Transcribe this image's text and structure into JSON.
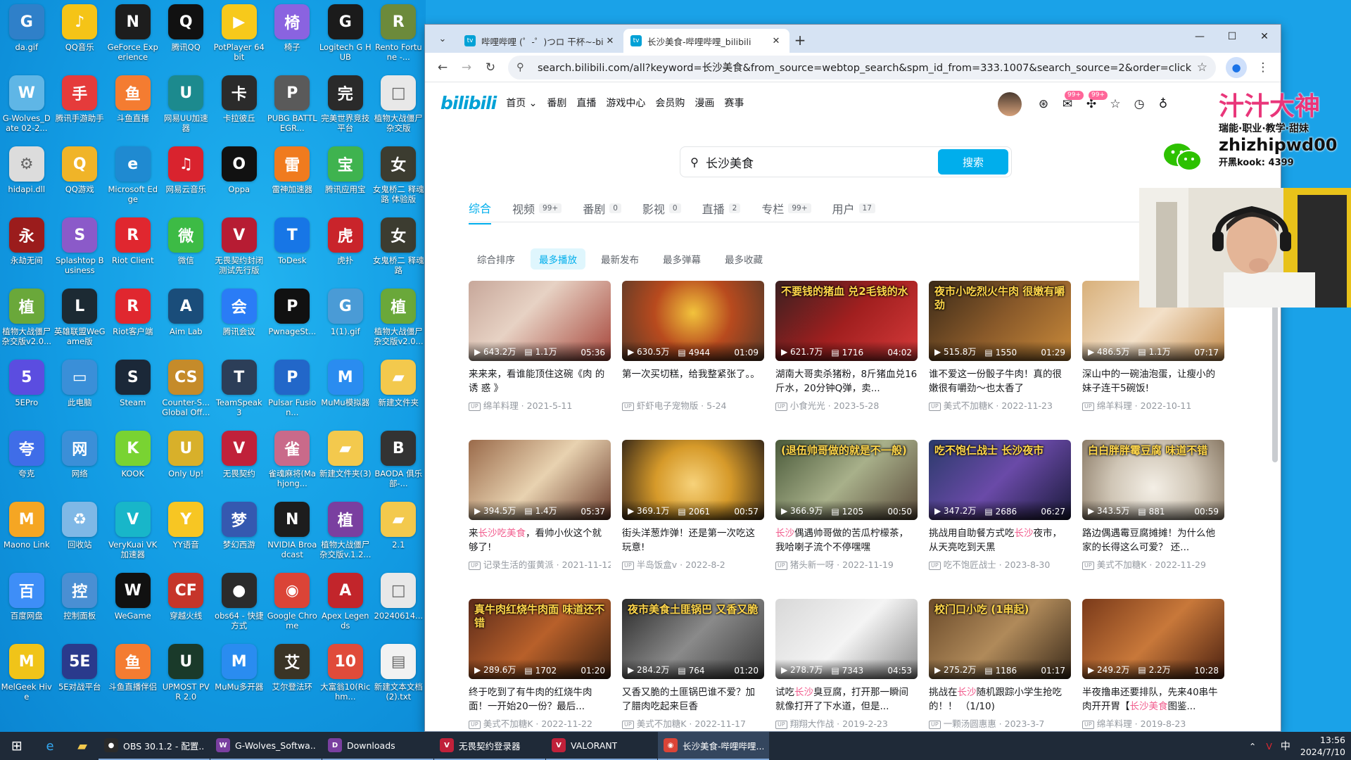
{
  "desktop": {
    "icons": [
      {
        "label": "da.gif",
        "color": "#2f80c9",
        "glyph": "G"
      },
      {
        "label": "QQ音乐",
        "color": "#f5c417",
        "glyph": "♪"
      },
      {
        "label": "GeForce Experience",
        "color": "#1d1d1d",
        "glyph": "N"
      },
      {
        "label": "腾讯QQ",
        "color": "#111111",
        "glyph": "Q"
      },
      {
        "label": "PotPlayer 64 bit",
        "color": "#f7c91b",
        "glyph": "▶"
      },
      {
        "label": "椅子",
        "color": "#8a63e0",
        "glyph": "椅"
      },
      {
        "label": "Logitech G HUB",
        "color": "#1b1b1b",
        "glyph": "G"
      },
      {
        "label": "Rento Fortune -...",
        "color": "#6c8a3b",
        "glyph": "R"
      },
      {
        "label": "G-Wolves_Date 02-2...",
        "color": "#5fb6e6",
        "glyph": "W"
      },
      {
        "label": "腾讯手游助手",
        "color": "#e53b3b",
        "glyph": "手"
      },
      {
        "label": "斗鱼直播",
        "color": "#f47c31",
        "glyph": "鱼"
      },
      {
        "label": "网易UU加速器",
        "color": "#1c8a8e",
        "glyph": "U"
      },
      {
        "label": "卡拉彼丘",
        "color": "#2b2b2b",
        "glyph": "卡"
      },
      {
        "label": "PUBG BATTLEGR...",
        "color": "#5a5a5a",
        "glyph": "P"
      },
      {
        "label": "完美世界竞技平台",
        "color": "#2a2a2a",
        "glyph": "完"
      },
      {
        "label": "植物大战僵尸杂交版",
        "color": "#e8e8e8",
        "glyph": "□"
      },
      {
        "label": "hidapi.dll",
        "color": "#dcdcdc",
        "glyph": "⚙"
      },
      {
        "label": "QQ游戏",
        "color": "#f0b428",
        "glyph": "Q"
      },
      {
        "label": "Microsoft Edge",
        "color": "#1f8ad1",
        "glyph": "e"
      },
      {
        "label": "网易云音乐",
        "color": "#d9232e",
        "glyph": "♫"
      },
      {
        "label": "Oppa",
        "color": "#111111",
        "glyph": "O"
      },
      {
        "label": "雷神加速器",
        "color": "#f07b1e",
        "glyph": "雷"
      },
      {
        "label": "腾讯应用宝",
        "color": "#3fb34f",
        "glyph": "宝"
      },
      {
        "label": "女鬼桥二 释魂路 体验版",
        "color": "#3c3c30",
        "glyph": "女"
      },
      {
        "label": "永劫无间",
        "color": "#9b1c1c",
        "glyph": "永"
      },
      {
        "label": "Splashtop Business",
        "color": "#8b5ac9",
        "glyph": "S"
      },
      {
        "label": "Riot Client",
        "color": "#e0272f",
        "glyph": "R"
      },
      {
        "label": "微信",
        "color": "#3dbb45",
        "glyph": "微"
      },
      {
        "label": "无畏契约封闭测试先行版",
        "color": "#b71c33",
        "glyph": "V"
      },
      {
        "label": "ToDesk",
        "color": "#1776e6",
        "glyph": "T"
      },
      {
        "label": "虎扑",
        "color": "#c9242b",
        "glyph": "虎"
      },
      {
        "label": "女鬼桥二 释魂路",
        "color": "#3c3c30",
        "glyph": "女"
      },
      {
        "label": "植物大战僵尸杂交版v2.0...",
        "color": "#6aa83a",
        "glyph": "植"
      },
      {
        "label": "英雄联盟WeGame版",
        "color": "#1c2a33",
        "glyph": "L"
      },
      {
        "label": "Riot客户端",
        "color": "#e0272f",
        "glyph": "R"
      },
      {
        "label": "Aim Lab",
        "color": "#1a4d7a",
        "glyph": "A"
      },
      {
        "label": "腾讯会议",
        "color": "#2a7cf6",
        "glyph": "会"
      },
      {
        "label": "PwnageSt...",
        "color": "#111111",
        "glyph": "P"
      },
      {
        "label": "1(1).gif",
        "color": "#4a9bd6",
        "glyph": "G"
      },
      {
        "label": "植物大战僵尸杂交版v2.0...",
        "color": "#6aa83a",
        "glyph": "植"
      },
      {
        "label": "5EPro",
        "color": "#5b4de0",
        "glyph": "5"
      },
      {
        "label": "此电脑",
        "color": "#3a8fd8",
        "glyph": "▭"
      },
      {
        "label": "Steam",
        "color": "#1b2838",
        "glyph": "S"
      },
      {
        "label": "Counter-S... Global Off...",
        "color": "#c58b2a",
        "glyph": "CS"
      },
      {
        "label": "TeamSpeak 3",
        "color": "#2c3e58",
        "glyph": "T"
      },
      {
        "label": "Pulsar Fusion...",
        "color": "#2267c9",
        "glyph": "P"
      },
      {
        "label": "MuMu模拟器",
        "color": "#2a8cf0",
        "glyph": "M"
      },
      {
        "label": "新建文件夹",
        "color": "#f3c94d",
        "glyph": "▰"
      },
      {
        "label": "夸克",
        "color": "#3f6de8",
        "glyph": "夸"
      },
      {
        "label": "网络",
        "color": "#3b8fd8",
        "glyph": "网"
      },
      {
        "label": "KOOK",
        "color": "#79d332",
        "glyph": "K"
      },
      {
        "label": "Only Up!",
        "color": "#d8b02a",
        "glyph": "U"
      },
      {
        "label": "无畏契约",
        "color": "#c0213a",
        "glyph": "V"
      },
      {
        "label": "雀魂麻将(Mahjong...",
        "color": "#c96a8a",
        "glyph": "雀"
      },
      {
        "label": "新建文件夹(3)",
        "color": "#f3c94d",
        "glyph": "▰"
      },
      {
        "label": "BAODA 俱乐部-...",
        "color": "#333333",
        "glyph": "B"
      },
      {
        "label": "Maono Link",
        "color": "#f5a623",
        "glyph": "M"
      },
      {
        "label": "回收站",
        "color": "#7fb8e6",
        "glyph": "♻"
      },
      {
        "label": "VeryKuai VK加速器",
        "color": "#18b6c9",
        "glyph": "V"
      },
      {
        "label": "YY语音",
        "color": "#f7c623",
        "glyph": "Y"
      },
      {
        "label": "梦幻西游",
        "color": "#3559b0",
        "glyph": "梦"
      },
      {
        "label": "NVIDIA Broadcast",
        "color": "#1d1d1d",
        "glyph": "N"
      },
      {
        "label": "植物大战僵尸杂交版v.1.2...",
        "color": "#7a3fa0",
        "glyph": "植"
      },
      {
        "label": "2.1",
        "color": "#f3c94d",
        "glyph": "▰"
      },
      {
        "label": "百度网盘",
        "color": "#3e8ef7",
        "glyph": "百"
      },
      {
        "label": "控制面板",
        "color": "#4a8fd3",
        "glyph": "控"
      },
      {
        "label": "WeGame",
        "color": "#111111",
        "glyph": "W"
      },
      {
        "label": "穿越火线",
        "color": "#c6352a",
        "glyph": "CF"
      },
      {
        "label": "obs64 - 快捷方式",
        "color": "#2b2b2b",
        "glyph": "●"
      },
      {
        "label": "Google Chrome",
        "color": "#db4437",
        "glyph": "◉"
      },
      {
        "label": "Apex Legends",
        "color": "#c2252b",
        "glyph": "A"
      },
      {
        "label": "20240614...",
        "color": "#e8e8e8",
        "glyph": "□"
      },
      {
        "label": "MelGeek Hive",
        "color": "#f0c419",
        "glyph": "M"
      },
      {
        "label": "5E对战平台",
        "color": "#2a3a8c",
        "glyph": "5E"
      },
      {
        "label": "斗鱼直播伴侣",
        "color": "#f47c31",
        "glyph": "鱼"
      },
      {
        "label": "UPMOST PVR 2.0",
        "color": "#1a3a2a",
        "glyph": "U"
      },
      {
        "label": "MuMu多开器",
        "color": "#2a8cf0",
        "glyph": "M"
      },
      {
        "label": "艾尔登法环",
        "color": "#3a3426",
        "glyph": "艾"
      },
      {
        "label": "大富翁10(Richm...",
        "color": "#e04b3a",
        "glyph": "10"
      },
      {
        "label": "新建文本文档(2).txt",
        "color": "#f2f2f2",
        "glyph": "▤"
      }
    ]
  },
  "browser": {
    "tabs": [
      {
        "title": "哔哩哔哩 (゜-゜)つロ 干杯~-bi",
        "active": false
      },
      {
        "title": "长沙美食-哔哩哔哩_bilibili",
        "active": true
      }
    ],
    "url": "search.bilibili.com/all?keyword=长沙美食&from_source=webtop_search&spm_id_from=333.1007&search_source=2&order=click"
  },
  "bili": {
    "logo": "bilibili",
    "nav": [
      "首页",
      "番剧",
      "直播",
      "游戏中心",
      "会员购",
      "漫画",
      "赛事"
    ],
    "badges": [
      "99+",
      "99+"
    ],
    "search_query": "长沙美食",
    "search_button": "搜索",
    "type_tabs": [
      {
        "label": "综合",
        "count": ""
      },
      {
        "label": "视频",
        "count": "99+"
      },
      {
        "label": "番剧",
        "count": "0"
      },
      {
        "label": "影视",
        "count": "0"
      },
      {
        "label": "直播",
        "count": "2"
      },
      {
        "label": "专栏",
        "count": "99+"
      },
      {
        "label": "用户",
        "count": "17"
      }
    ],
    "sorts": [
      "综合排序",
      "最多播放",
      "最新发布",
      "最多弹幕",
      "最多收藏"
    ],
    "active_sort": "最多播放",
    "videos": [
      {
        "views": "643.2万",
        "danmaku": "1.1万",
        "duration": "05:36",
        "title_pre": "来来来，看谁能顶住这碗《肉 的 诱 惑 》",
        "hl": "",
        "title_post": "",
        "uploader": "绵羊料理",
        "date": "2021-5-11",
        "caption": "",
        "bg": "linear-gradient(135deg,#c7a79a,#e7d2c4 40%,#a6453a)"
      },
      {
        "views": "630.5万",
        "danmaku": "4944",
        "duration": "01:09",
        "title_pre": "第一次买切糕，给我整紧张了。。",
        "hl": "",
        "title_post": "",
        "uploader": "虾虾电子宠物版",
        "date": "5-24",
        "caption": "",
        "bg": "radial-gradient(circle at 50% 40%,#f2c33c,#b84a1e 45%,#5a3a28)"
      },
      {
        "views": "621.7万",
        "danmaku": "1716",
        "duration": "04:02",
        "title_pre": "湖南大哥卖杀猪粉，8斤猪血兑16斤水，20分钟Q弹，卖...",
        "hl": "",
        "title_post": "",
        "uploader": "小食光光",
        "date": "2023-5-28",
        "caption": "不要钱的猪血 兑2毛钱的水",
        "bg": "linear-gradient(135deg,#3a2020,#a11f1f 50%,#d63a3a)"
      },
      {
        "views": "515.8万",
        "danmaku": "1550",
        "duration": "01:29",
        "title_pre": "谁不爱这一份骰子牛肉！真的很嫩很有嚼劲～也太香了",
        "hl": "",
        "title_post": "",
        "uploader": "美式不加糖K",
        "date": "2022-11-23",
        "caption": "夜市小吃烈火牛肉 很嫩有嚼劲",
        "bg": "linear-gradient(135deg,#3a2a18,#8a5a2a 50%,#c98a3a)"
      },
      {
        "views": "486.5万",
        "danmaku": "1.1万",
        "duration": "07:17",
        "title_pre": "深山中的一碗油泡蛋，让瘦小的妹子连干5碗饭!",
        "hl": "",
        "title_post": "",
        "uploader": "绵羊料理",
        "date": "2022-10-11",
        "caption": "",
        "bg": "linear-gradient(135deg,#d8b07a,#f3e0c8 50%,#c28a4a)"
      },
      {
        "views": "394.5万",
        "danmaku": "1.4万",
        "duration": "05:37",
        "title_pre": "来",
        "hl": "长沙吃美食",
        "title_post": "，看帅小伙这个就够了!",
        "uploader": "记录生活的蛋黄派",
        "date": "2021-11-12",
        "caption": "",
        "bg": "linear-gradient(135deg,#9a6a4a,#e8d2b0 50%,#6a3a2a)"
      },
      {
        "views": "369.1万",
        "danmaku": "2061",
        "duration": "00:57",
        "title_pre": "街头洋葱炸弹！还是第一次吃这玩意!",
        "hl": "",
        "title_post": "",
        "uploader": "半岛饭盒v",
        "date": "2022-8-2",
        "caption": "",
        "bg": "radial-gradient(circle at 50% 55%,#f7d27a,#d69a2a 45%,#3a2a18)"
      },
      {
        "views": "366.9万",
        "danmaku": "1205",
        "duration": "00:50",
        "title_pre": "",
        "hl": "长沙",
        "title_post": "偶遇帅哥做的苦瓜柠檬茶，我哈喇子流个不停嘿嘿",
        "uploader": "猪头新一呀",
        "date": "2022-11-19",
        "caption": "(退伍帅哥做的就是不一般)",
        "bg": "linear-gradient(135deg,#4a5a3a,#a8b08a 50%,#5a4a3a)"
      },
      {
        "views": "347.2万",
        "danmaku": "2686",
        "duration": "06:27",
        "title_pre": "挑战用自助餐方式吃",
        "hl": "长沙",
        "title_post": "夜市，从天亮吃到天黑",
        "uploader": "吃不饱匠战士",
        "date": "2023-8-30",
        "caption": "吃不饱仁战士 长沙夜市",
        "bg": "linear-gradient(135deg,#2a3a6a,#6a4aa8 50%,#1a1a3a)"
      },
      {
        "views": "343.5万",
        "danmaku": "881",
        "duration": "00:59",
        "title_pre": "路边偶遇霉豆腐摊摊！为什么他家的长得这么可爱？ 还...",
        "hl": "",
        "title_post": "",
        "uploader": "美式不加糖K",
        "date": "2022-11-29",
        "caption": "白白胖胖霉豆腐 味道不错",
        "bg": "radial-gradient(circle at 50% 60%,#f4efe6,#cfc5b5 50%,#8a7a66)"
      },
      {
        "views": "289.6万",
        "danmaku": "1702",
        "duration": "01:20",
        "title_pre": "终于吃到了有牛肉的红烧牛肉面！一开始20一份？最后...",
        "hl": "",
        "title_post": "",
        "uploader": "美式不加糖K",
        "date": "2022-11-22",
        "caption": "真牛肉红烧牛肉面 味道还不错",
        "bg": "linear-gradient(135deg,#5a2a1a,#b8602a 50%,#3a2010)"
      },
      {
        "views": "284.2万",
        "danmaku": "764",
        "duration": "01:20",
        "title_pre": "又香又脆的土匪锅巴谁不爱？加了腊肉吃起来巨香",
        "hl": "",
        "title_post": "",
        "uploader": "美式不加糖K",
        "date": "2022-11-17",
        "caption": "夜市美食土匪锅巴 又香又脆",
        "bg": "linear-gradient(135deg,#2a2a2a,#8a8a8a 50%,#3a3a3a)"
      },
      {
        "views": "278.7万",
        "danmaku": "7343",
        "duration": "04:53",
        "title_pre": "试吃",
        "hl": "长沙",
        "title_post": "臭豆腐，打开那一瞬间就像打开了下水道，但是...",
        "uploader": "翔翔大作战",
        "date": "2019-2-23",
        "caption": "",
        "bg": "linear-gradient(135deg,#d8d8d8,#f4f4f4 50%,#8a8a8a)"
      },
      {
        "views": "275.2万",
        "danmaku": "1186",
        "duration": "01:17",
        "title_pre": "挑战在",
        "hl": "长沙",
        "title_post": "随机跟踪小学生抢吃的！！ （1/10)",
        "uploader": "一颗汤圆惠惠",
        "date": "2023-3-7",
        "caption": "校门口小吃 (1串起)",
        "bg": "linear-gradient(135deg,#6a4a2a,#b08a5a 50%,#3a2a1a)"
      },
      {
        "views": "249.2万",
        "danmaku": "2.2万",
        "duration": "10:28",
        "title_pre": "半夜撸串还要排队，先来40串牛肉开开胃【",
        "hl": "长沙美食",
        "title_post": "图鉴...",
        "uploader": "绵羊料理",
        "date": "2019-8-23",
        "caption": "",
        "bg": "linear-gradient(135deg,#7a3a1a,#c8783a 50%,#4a2010)"
      }
    ]
  },
  "overlay": {
    "brand": "汁汁大神",
    "subtitle": "瑞能·职业·教学·甜妹",
    "handle": "zhizhipwd00",
    "fans": "开黑kook: 4399"
  },
  "taskbar": {
    "apps": [
      {
        "label": "OBS 30.1.2 - 配置...",
        "color": "#2b2b2b",
        "glyph": "●",
        "active": false
      },
      {
        "label": "G-Wolves_Softwa...",
        "color": "#7a3fa0",
        "glyph": "W",
        "active": false
      },
      {
        "label": "Downloads",
        "color": "#7a3fa0",
        "glyph": "D",
        "active": false
      },
      {
        "label": "无畏契约登录器",
        "color": "#c0213a",
        "glyph": "V",
        "active": false
      },
      {
        "label": "VALORANT",
        "color": "#c0213a",
        "glyph": "V",
        "active": false
      },
      {
        "label": "长沙美食-哔哩哔哩...",
        "color": "#db4437",
        "glyph": "◉",
        "active": true
      }
    ],
    "ime": "中",
    "time": "13:56",
    "date": "2024/7/10"
  }
}
